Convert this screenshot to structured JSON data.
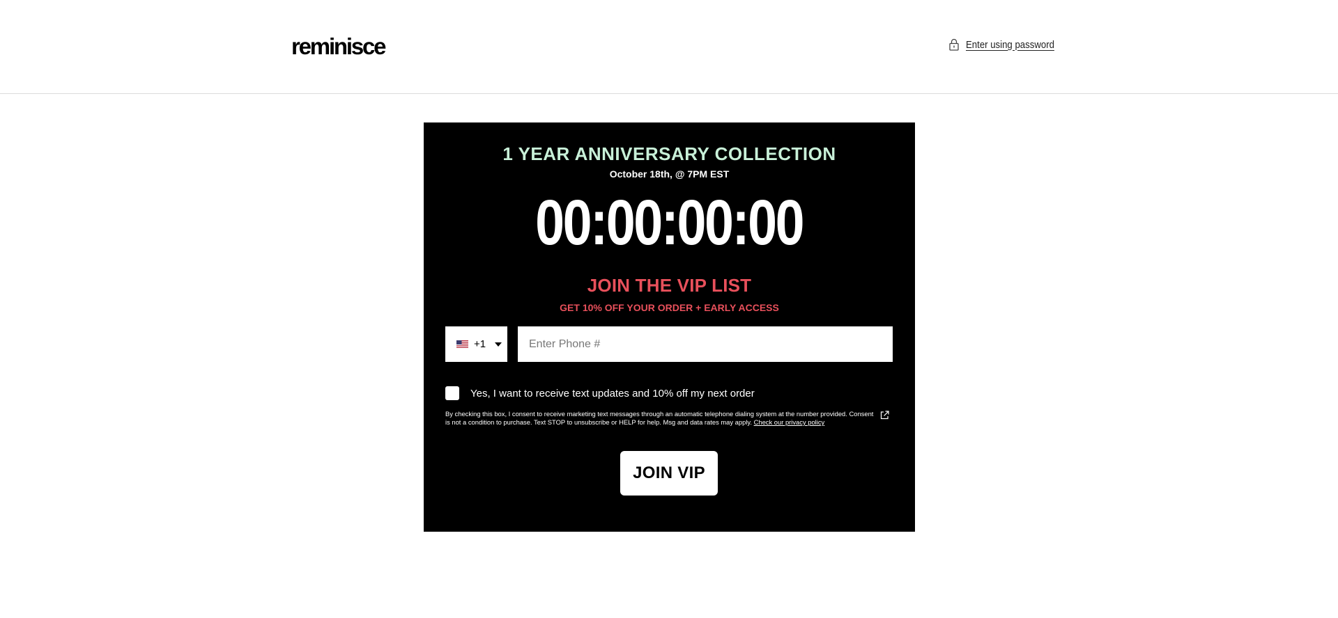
{
  "header": {
    "logo_text": "reminisce",
    "password_link": "Enter using password",
    "lock_icon": "lock-icon"
  },
  "promo": {
    "title": "1 YEAR ANNIVERSARY COLLECTION",
    "date": "October 18th, @ 7PM EST",
    "countdown": "00:00:00:00",
    "vip_title": "JOIN THE VIP LIST",
    "vip_subtitle": "GET 10% OFF YOUR ORDER + EARLY ACCESS",
    "country_code": "+1",
    "country_flag": "us-flag-icon",
    "phone_placeholder": "Enter Phone #",
    "phone_value": "",
    "consent_label": "Yes, I want to receive text updates and 10% off my next order",
    "consent_checked": false,
    "disclaimer": "By checking this box, I consent to receive marketing text messages through an automatic telephone dialing system at the number provided. Consent is not a condition to purchase. Text STOP to unsubscribe or HELP for help. Msg and data rates may apply.",
    "privacy_link": "Check our privacy policy",
    "join_button": "JOIN VIP"
  },
  "colors": {
    "title_mint": "#c8f0d8",
    "accent_red": "#e8505b",
    "panel_bg": "#000000"
  }
}
